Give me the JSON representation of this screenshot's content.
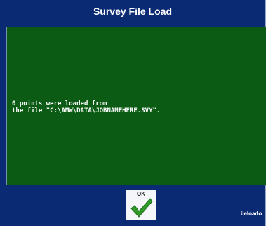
{
  "dialog": {
    "title": "Survey File Load",
    "message": "0 points were loaded from\nthe file \"C:\\AMW\\DATA\\JOBNAMEHERE.SVY\".",
    "ok_label": "OK",
    "ok_icon": "checkmark-icon",
    "footer_text": "ileloado"
  },
  "colors": {
    "dialog_background": "#0b2a74",
    "panel_background": "#0b5b14",
    "check_green": "#2f9a2a"
  }
}
